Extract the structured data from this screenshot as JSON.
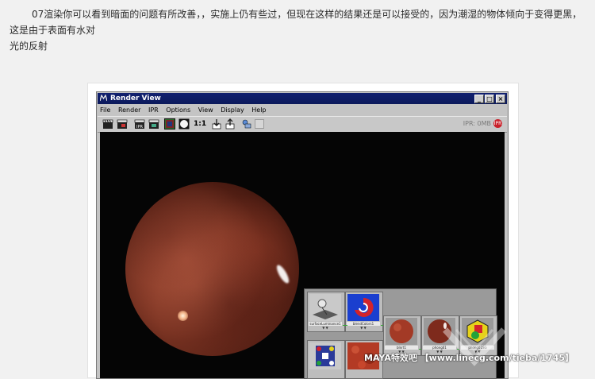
{
  "article": {
    "paragraph_line1": "07渲染你可以看到暗面的问题有所改善，，实施上仍有些过，但现在这样的结果还是可以接受的，因为潮湿的物体倾向于变得更黑，这是由于表面有水对",
    "paragraph_line2": "光的反射"
  },
  "window": {
    "title": "Render View",
    "controls": [
      "_",
      "□",
      "×"
    ]
  },
  "menu": [
    "File",
    "Render",
    "IPR",
    "Options",
    "View",
    "Display",
    "Help"
  ],
  "toolbar": {
    "zoom_label": "1:1",
    "ipr_status": "IPR: 0MB",
    "ipr_badge": "IPR"
  },
  "hypershade_nodes": [
    {
      "label": "surfaceLuminance1"
    },
    {
      "label": "blendColors1"
    },
    {
      "label": "bInrt1"
    },
    {
      "label": "phong01"
    },
    {
      "label": "phong01SG"
    }
  ],
  "watermark": {
    "text": "MAYA特效吧  【www.linecg.com/tieba/1745】"
  },
  "colors": {
    "titlebar": "#11206f",
    "window_bg": "#c4c4c4",
    "viewport_bg": "#050505",
    "sphere": "#7a3322",
    "connection": "#38a838"
  }
}
